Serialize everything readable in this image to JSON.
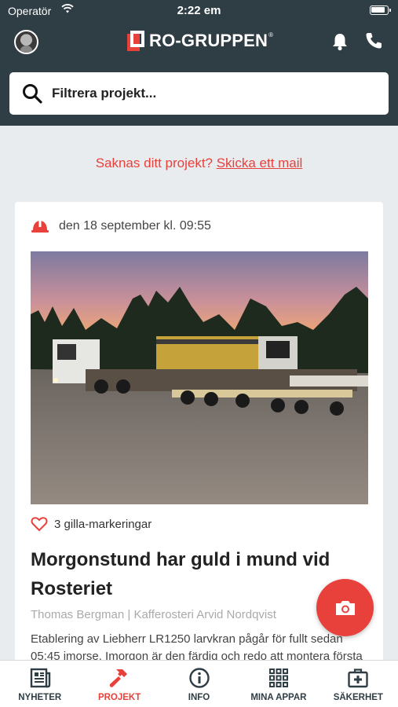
{
  "status_bar": {
    "carrier": "Operatör",
    "time": "2:22 em"
  },
  "header": {
    "logo_text": "RO-GRUPPEN",
    "logo_reg": "®"
  },
  "search": {
    "placeholder": "Filtrera projekt..."
  },
  "missing": {
    "prefix": "Saknas ditt projekt? ",
    "link": "Skicka ett mail"
  },
  "card": {
    "date": "den 18 september kl. 09:55",
    "likes": "3 gilla-markeringar",
    "title": "Morgonstund har guld i mund vid Rosteriet",
    "meta": "Thomas Bergman | Kafferosteri Arvid Nordqvist",
    "excerpt": "Etablering av Liebherr LR1250 larvkran pågår för fullt sedan 05:45 imorse. Imorgon är den färdig och redo att montera första"
  },
  "nav": {
    "items": [
      {
        "label": "NYHETER"
      },
      {
        "label": "PROJEKT"
      },
      {
        "label": "INFO"
      },
      {
        "label": "MINA APPAR"
      },
      {
        "label": "SÄKERHET"
      }
    ]
  },
  "colors": {
    "accent": "#e8413c",
    "header": "#2f3d45",
    "background": "#e9ecef"
  }
}
